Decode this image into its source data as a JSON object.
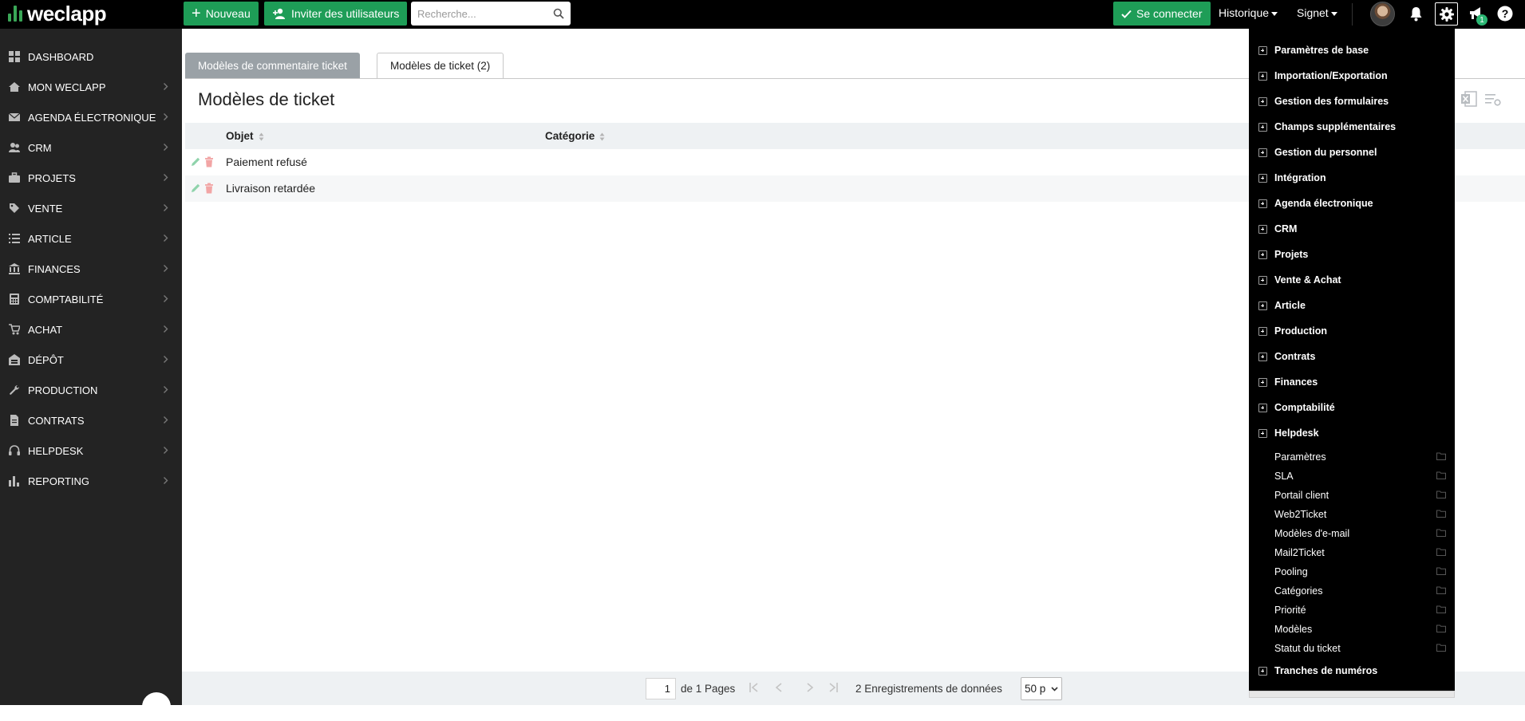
{
  "app": {
    "logo_text": "weclapp",
    "brand_color": "#1e9d57"
  },
  "topbar": {
    "new_label": "Nouveau",
    "invite_label": "Inviter des utilisateurs",
    "search_placeholder": "Recherche...",
    "connect_label": "Se connecter",
    "history_label": "Historique",
    "bookmark_label": "Signet",
    "notifications_badge": "1"
  },
  "sidebar": {
    "items": [
      {
        "label": "DASHBOARD",
        "icon": "dashboard-icon"
      },
      {
        "label": "MON WECLAPP",
        "icon": "home-icon"
      },
      {
        "label": "AGENDA ÉLECTRONIQUE",
        "icon": "mail-icon"
      },
      {
        "label": "CRM",
        "icon": "users-icon"
      },
      {
        "label": "PROJETS",
        "icon": "briefcase-icon"
      },
      {
        "label": "VENTE",
        "icon": "tag-icon"
      },
      {
        "label": "ARTICLE",
        "icon": "list-icon"
      },
      {
        "label": "FINANCES",
        "icon": "bank-icon"
      },
      {
        "label": "COMPTABILITÉ",
        "icon": "calculator-icon"
      },
      {
        "label": "ACHAT",
        "icon": "cart-icon"
      },
      {
        "label": "DÉPÔT",
        "icon": "warehouse-icon"
      },
      {
        "label": "PRODUCTION",
        "icon": "wrench-icon"
      },
      {
        "label": "CONTRATS",
        "icon": "document-icon"
      },
      {
        "label": "HELPDESK",
        "icon": "headset-icon"
      },
      {
        "label": "REPORTING",
        "icon": "bar-chart-icon"
      }
    ]
  },
  "main": {
    "tabs": [
      {
        "label": "Modèles de commentaire ticket",
        "active": false
      },
      {
        "label": "Modèles de ticket (2)",
        "active": true
      }
    ],
    "title": "Modèles de ticket",
    "table": {
      "columns": [
        "Objet",
        "Catégorie"
      ],
      "rows": [
        {
          "objet": "Paiement refusé",
          "categorie": ""
        },
        {
          "objet": "Livraison retardée",
          "categorie": ""
        }
      ]
    },
    "pager": {
      "current_page": "1",
      "of_pages": "de 1 Pages",
      "records": "2 Enregistrements de données",
      "page_size": "50 p"
    }
  },
  "settings_menu": {
    "sections": [
      "Paramètres de base",
      "Importation/Exportation",
      "Gestion des formulaires",
      "Champs supplémentaires",
      "Gestion du personnel",
      "Intégration",
      "Agenda électronique",
      "CRM",
      "Projets",
      "Vente & Achat",
      "Article",
      "Production",
      "Contrats",
      "Finances",
      "Comptabilité",
      "Helpdesk"
    ],
    "helpdesk_children": [
      "Paramètres",
      "SLA",
      "Portail client",
      "Web2Ticket",
      "Modèles d'e-mail",
      "Mail2Ticket",
      "Pooling",
      "Catégories",
      "Priorité",
      "Modèles",
      "Statut du ticket"
    ],
    "last_section": "Tranches de numéros"
  }
}
